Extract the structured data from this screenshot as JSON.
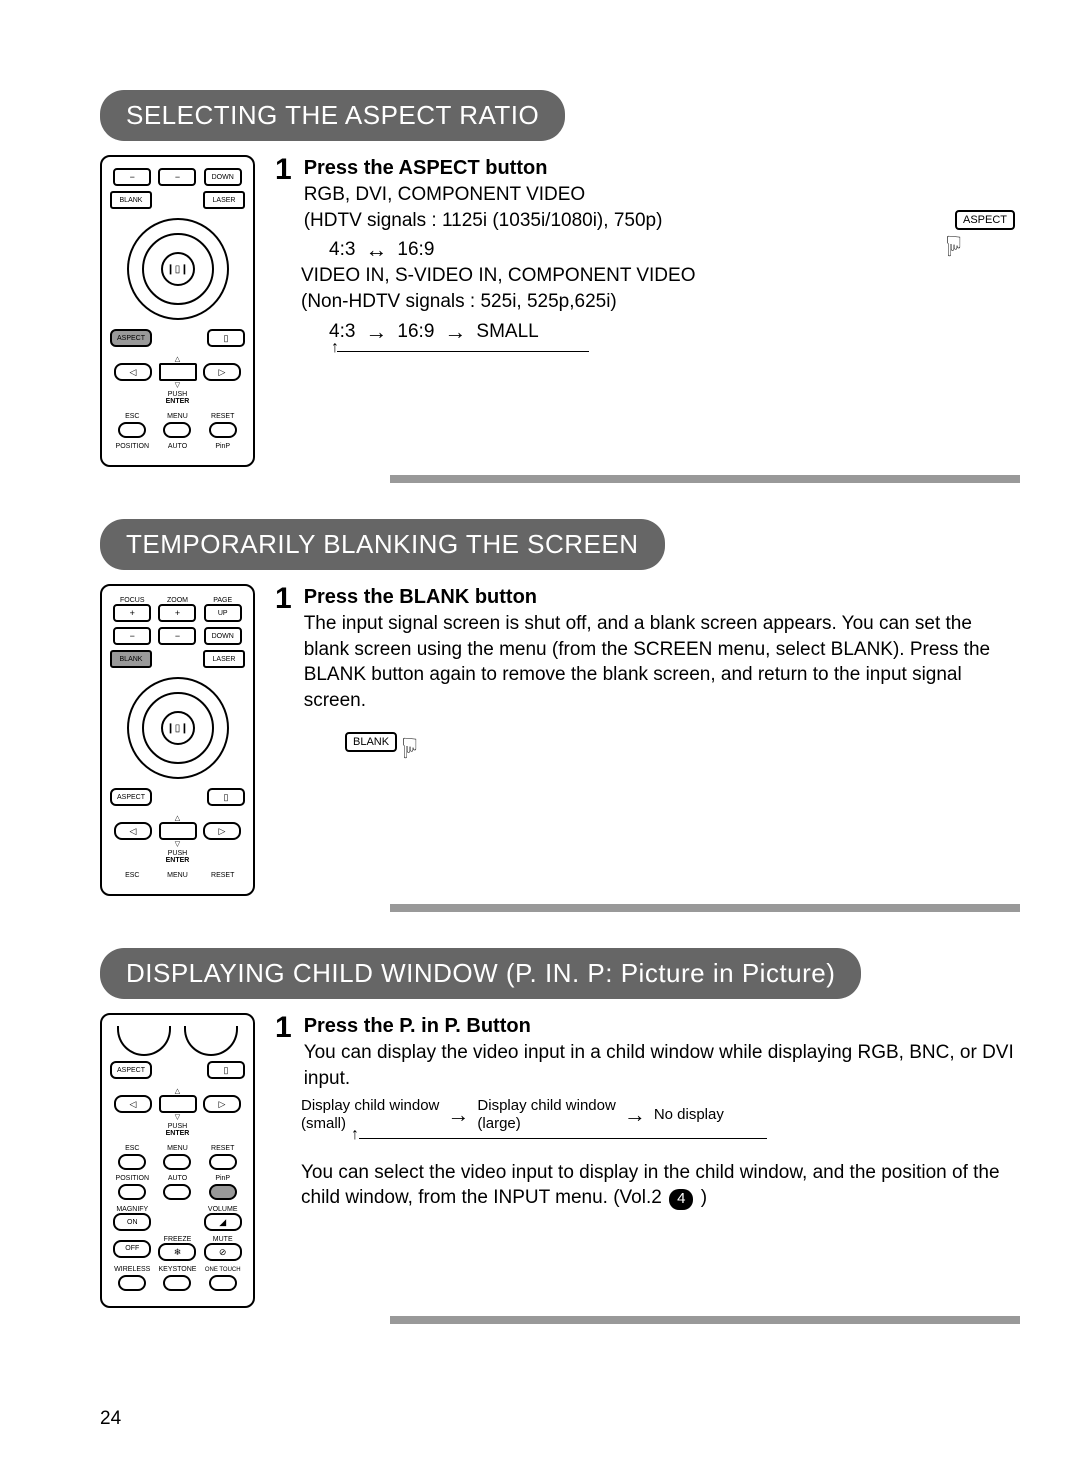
{
  "page_number": "24",
  "sections": {
    "aspect": {
      "heading": "SELECTING THE ASPECT RATIO",
      "step_num": "1",
      "step_title": "Press the ASPECT button",
      "line1": "RGB, DVI, COMPONENT VIDEO",
      "line2": "(HDTV signals : 1125i (1035i/1080i), 750p)",
      "seq_43": "4:3",
      "seq_169": "16:9",
      "line3": "VIDEO IN, S-VIDEO IN, COMPONENT VIDEO",
      "line4": "(Non-HDTV signals : 525i, 525p,625i)",
      "seq2_43": "4:3",
      "seq2_169": "16:9",
      "seq2_small": "SMALL",
      "icon_label": "ASPECT"
    },
    "blank": {
      "heading": "TEMPORARILY BLANKING THE SCREEN",
      "step_num": "1",
      "step_title": "Press the BLANK button",
      "body": "The input signal screen is shut off, and a blank screen appears. You can set the blank screen using the menu (from the SCREEN menu, select BLANK). Press the BLANK button again to remove the blank screen, and return to the input signal screen.",
      "icon_label": "BLANK"
    },
    "pip": {
      "heading": "DISPLAYING CHILD WINDOW (P. IN. P: Picture in Picture)",
      "step_num": "1",
      "step_title": "Press the P. in P. Button",
      "body1": "You can display the video input in a child window while displaying RGB, BNC, or DVI input.",
      "seq_small_l1": "Display child window",
      "seq_small_l2": "(small)",
      "seq_large_l1": "Display child window",
      "seq_large_l2": "(large)",
      "seq_none": "No display",
      "body2a": "You can select the video input to display in the child window, and the position of the child window, from the INPUT menu. (Vol.2",
      "body2_badge": "4",
      "body2b": ")"
    }
  },
  "remote_labels": {
    "focus": "FOCUS",
    "zoom": "ZOOM",
    "page": "PAGE",
    "up": "UP",
    "down": "DOWN",
    "blank": "BLANK",
    "laser": "LASER",
    "aspect": "ASPECT",
    "push": "PUSH",
    "enter": "ENTER",
    "esc": "ESC",
    "menu": "MENU",
    "reset": "RESET",
    "position": "POSITION",
    "auto": "AUTO",
    "pinp": "PinP",
    "magnify": "MAGNIFY",
    "on": "ON",
    "volume": "VOLUME",
    "off": "OFF",
    "freeze": "FREEZE",
    "mute": "MUTE",
    "wireless": "WIRELESS",
    "keystone": "KEYSTONE",
    "onetouch": "ONE TOUCH"
  },
  "icons": {
    "darrow": "↔",
    "rarrow": "→",
    "uarrow_turn": "↑",
    "hand": "☟"
  }
}
